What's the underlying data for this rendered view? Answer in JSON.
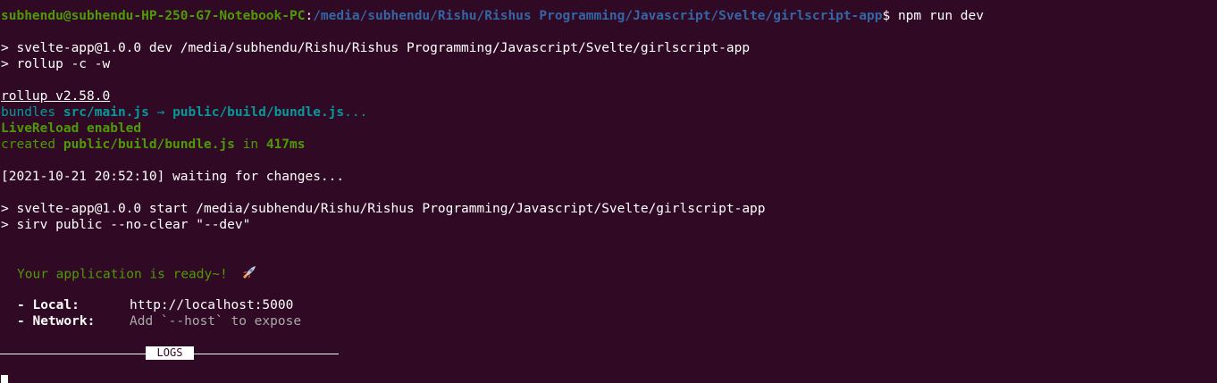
{
  "prompt": {
    "user_host": "subhendu@subhendu-HP-250-G7-Notebook-PC",
    "colon": ":",
    "path": "/media/subhendu/Rishu/Rishus Programming/Javascript/Svelte/girlscript-app",
    "symbol": "$ ",
    "command": "npm run dev"
  },
  "npm_dev": {
    "line1": "> svelte-app@1.0.0 dev /media/subhendu/Rishu/Rishus Programming/Javascript/Svelte/girlscript-app",
    "line2": "> rollup -c -w"
  },
  "rollup": {
    "version": "rollup v2.58.0",
    "bundles_word": "bundles ",
    "input": "src/main.js",
    "arrow": " → ",
    "output": "public/build/bundle.js",
    "ellipsis": "...",
    "livereload": "LiveReload enabled",
    "created_word": "created ",
    "created_file": "public/build/bundle.js",
    "in_word": " in ",
    "duration": "417ms"
  },
  "watch": {
    "waiting": "[2021-10-21 20:52:10] waiting for changes..."
  },
  "npm_start": {
    "line1": "> svelte-app@1.0.0 start /media/subhendu/Rishu/Rishus Programming/Javascript/Svelte/girlscript-app",
    "line2": "> sirv public --no-clear \"--dev\""
  },
  "sirv": {
    "ready": "Your application is ready~! ",
    "local_label": "- Local:",
    "local_value": "http://localhost:5000",
    "network_label": "- Network:",
    "network_value": "Add `--host` to expose"
  },
  "logs": {
    "label": "LOGS"
  },
  "colors": {
    "background": "#300a24",
    "green": "#4e9a06",
    "blue": "#3465a4",
    "cyan": "#06989a",
    "text": "#ffffff",
    "muted": "#a8a8a8"
  },
  "icons": {
    "rocket": "rocket-icon"
  }
}
